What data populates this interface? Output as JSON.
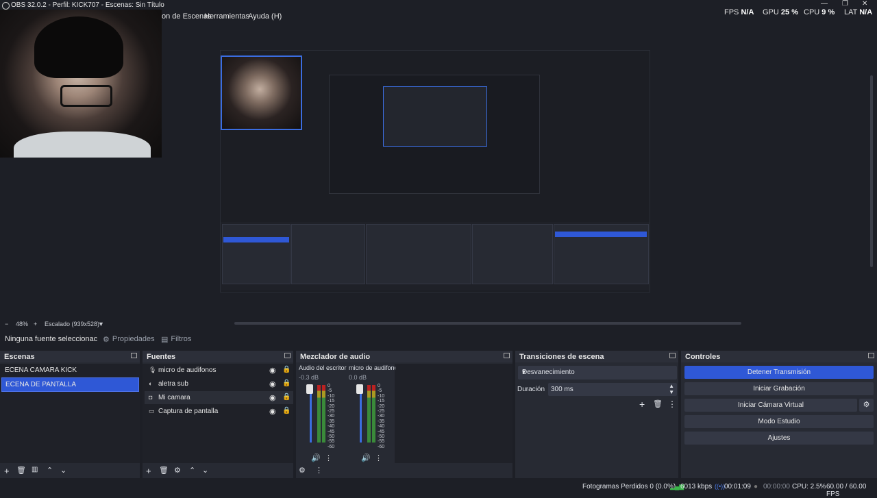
{
  "window": {
    "title": "OBS 32.0.2 - Perfil: KICK707 - Escenas: Sin Título"
  },
  "menu": {
    "items": [
      "on de Escenas",
      "Herramientas",
      "Ayuda (H)"
    ]
  },
  "stats": {
    "fps_label": "FPS",
    "fps_value": "N/A",
    "gpu_label": "GPU",
    "gpu_value": "25 %",
    "cpu_label": "CPU",
    "cpu_value": "9 %",
    "lat_label": "LAT",
    "lat_value": "N/A"
  },
  "zoom": {
    "minus": "−",
    "value": "48%",
    "plus": "+",
    "scale": "Escalado (939x528)"
  },
  "context_bar": {
    "no_source": "Ninguna fuente seleccionac",
    "properties": "Propiedades",
    "filters": "Filtros"
  },
  "scenes": {
    "title": "Escenas",
    "items": [
      {
        "label": "ECENA CAMARA KICK",
        "selected": false
      },
      {
        "label": "ECENA DE PANTALLA",
        "selected": true
      }
    ]
  },
  "sources": {
    "title": "Fuentes",
    "items": [
      {
        "label": "micro de audifonos",
        "icon": "microphone-icon"
      },
      {
        "label": "aletra sub",
        "icon": "browser-icon"
      },
      {
        "label": "Mi camara",
        "icon": "camera-icon"
      },
      {
        "label": "Captura de pantalla",
        "icon": "monitor-icon"
      }
    ]
  },
  "mixer": {
    "title": "Mezclador de audio",
    "channels": [
      {
        "name": "Audio del escritorio",
        "db": "-0.3 dB"
      },
      {
        "name": "micro de audifonos",
        "db": "0.0 dB"
      }
    ],
    "ticks": [
      "0",
      "-5",
      "-10",
      "-15",
      "-20",
      "-25",
      "-30",
      "-35",
      "-40",
      "-45",
      "-50",
      "-55",
      "-60"
    ]
  },
  "transitions": {
    "title": "Transiciones de escena",
    "selected": "Desvanecimiento",
    "duration_label": "Duración",
    "duration_value": "300 ms"
  },
  "controls": {
    "title": "Controles",
    "buttons": [
      "Detener Transmisión",
      "Iniciar Grabación",
      "Iniciar Cámara Virtual",
      "Modo Estudio",
      "Ajustes"
    ]
  },
  "status": {
    "dropped": "Fotogramas Perdidos 0 (0.0%)",
    "bitrate": "6013 kbps",
    "stream_time": "00:01:09",
    "rec_time": "00:00:00",
    "cpu": "CPU: 2.5%",
    "fps": "60.00 / 60.00 FPS"
  },
  "colors": {
    "accent": "#2f58d6",
    "bg": "#1d1f26",
    "panel": "#272a33"
  }
}
